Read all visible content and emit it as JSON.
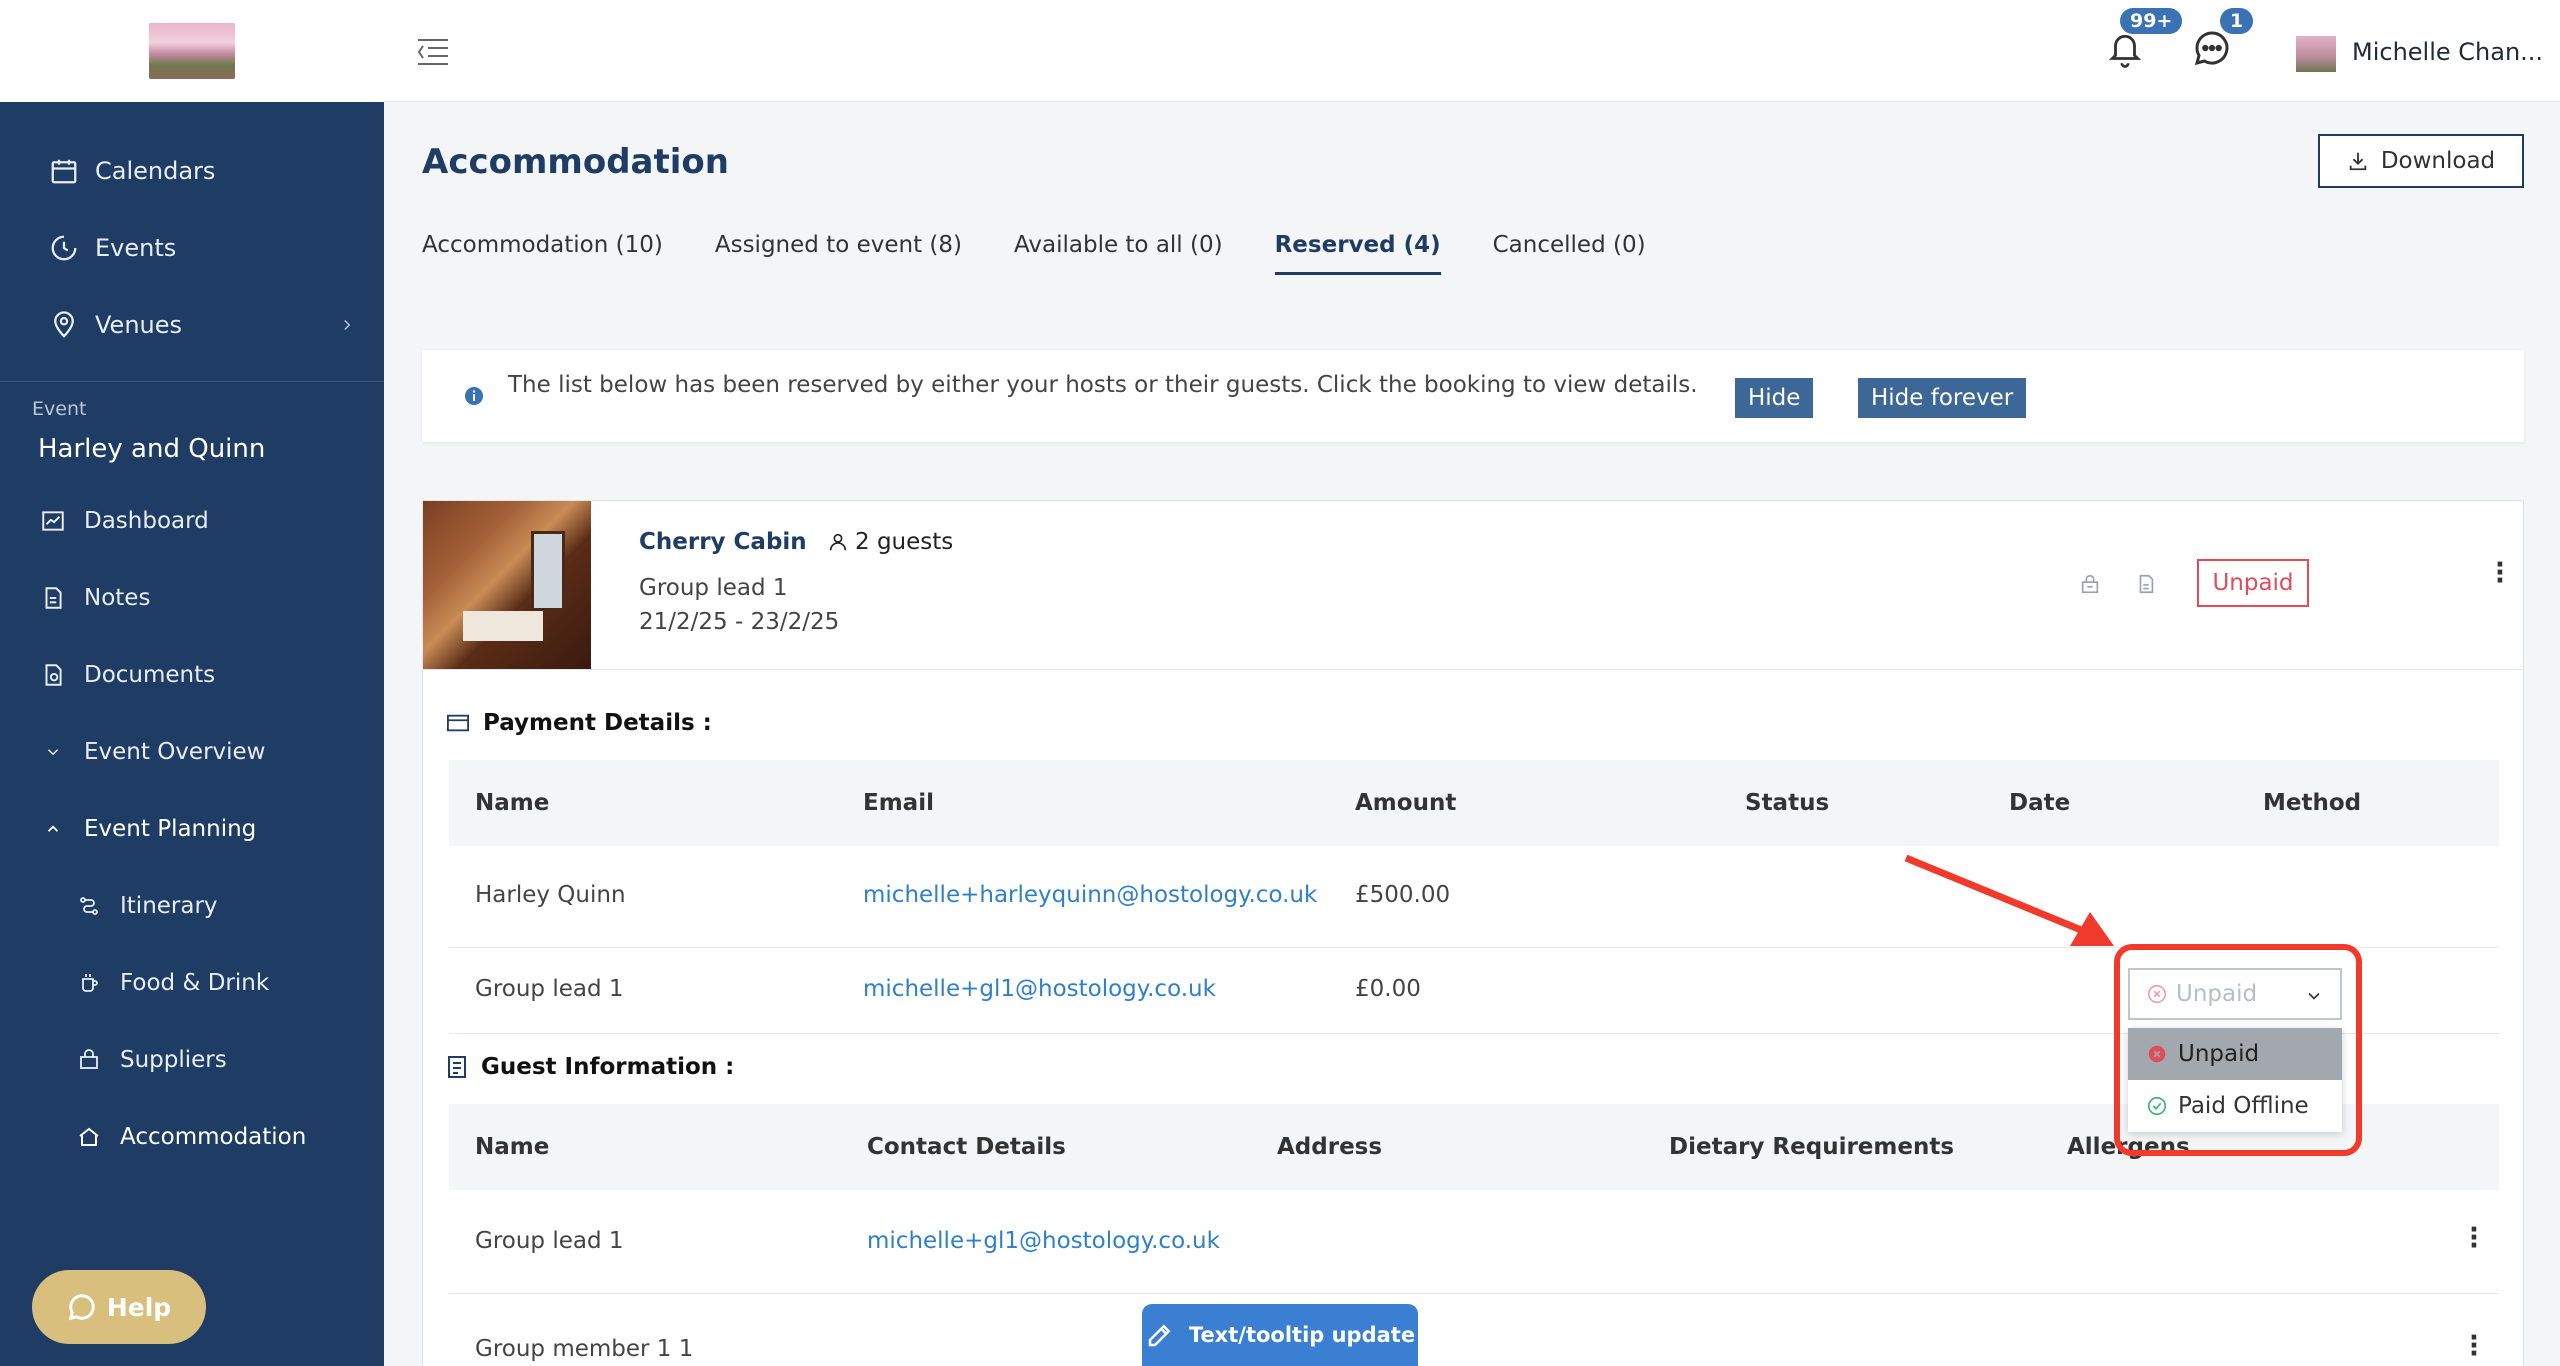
{
  "sidebar": {
    "nav": [
      {
        "label": "Calendars",
        "icon": "calendar-icon"
      },
      {
        "label": "Events",
        "icon": "events-icon"
      },
      {
        "label": "Venues",
        "icon": "location-pin-icon"
      }
    ],
    "event_label": "Event",
    "event_name": "Harley and Quinn",
    "event_nav": [
      {
        "label": "Dashboard",
        "icon": "dashboard-icon"
      },
      {
        "label": "Notes",
        "icon": "notes-icon"
      },
      {
        "label": "Documents",
        "icon": "documents-icon"
      },
      {
        "label": "Event Overview",
        "icon": "chevron-down-icon"
      },
      {
        "label": "Event Planning",
        "icon": "chevron-up-icon"
      }
    ],
    "planning_nav": [
      {
        "label": "Itinerary",
        "icon": "itinerary-icon"
      },
      {
        "label": "Food & Drink",
        "icon": "food-drink-icon"
      },
      {
        "label": "Suppliers",
        "icon": "suppliers-icon"
      },
      {
        "label": "Accommodation",
        "icon": "home-icon"
      }
    ],
    "help_label": "Help"
  },
  "topbar": {
    "notifications_badge": "99+",
    "messages_badge": "1",
    "user_name": "Michelle Chan..."
  },
  "page": {
    "title": "Accommodation",
    "download_label": "Download",
    "tabs": [
      {
        "label": "Accommodation (10)",
        "active": false
      },
      {
        "label": "Assigned to event (8)",
        "active": false
      },
      {
        "label": "Available to all (0)",
        "active": false
      },
      {
        "label": "Reserved (4)",
        "active": true
      },
      {
        "label": "Cancelled (0)",
        "active": false
      }
    ],
    "info": {
      "text": "The list below has been reserved by either your hosts or their guests. Click the booking to view details.",
      "hide_label": "Hide",
      "hide_forever_label": "Hide forever"
    }
  },
  "booking": {
    "name": "Cherry Cabin",
    "guests": "2 guests",
    "group_lead": "Group lead 1",
    "dates": "21/2/25 - 23/2/25",
    "status": "Unpaid"
  },
  "payment": {
    "title": "Payment Details :",
    "headers": [
      "Name",
      "Email",
      "Amount",
      "Status",
      "Date",
      "Method"
    ],
    "rows": [
      {
        "name": "Harley Quinn",
        "email": "michelle+harleyquinn@hostology.co.uk",
        "amount": "£500.00"
      },
      {
        "name": "Group lead 1",
        "email": "michelle+gl1@hostology.co.uk",
        "amount": "£0.00"
      }
    ],
    "status_select": {
      "value": "Unpaid",
      "options": [
        "Unpaid",
        "Paid Offline"
      ]
    }
  },
  "guests": {
    "title": "Guest Information :",
    "headers": [
      "Name",
      "Contact Details",
      "Address",
      "Dietary Requirements",
      "Allergens"
    ],
    "rows": [
      {
        "name": "Group lead 1",
        "contact": "michelle+gl1@hostology.co.uk"
      },
      {
        "name": "Group member 1 1",
        "contact": ""
      }
    ]
  },
  "toast": {
    "label": "Text/tooltip update"
  },
  "colors": {
    "sidebar": "#1f3d64",
    "accent": "#3d6796",
    "danger": "#e24b5a",
    "link": "#2f80c9",
    "highlight": "#f03a2b",
    "help": "#d8bf7e"
  }
}
